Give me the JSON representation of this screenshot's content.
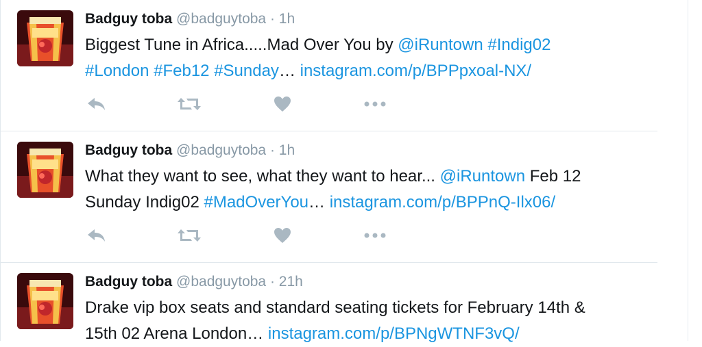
{
  "colors": {
    "name": "#14171a",
    "muted": "#8899a6",
    "link": "#1b95e0",
    "action_icon": "#aab8c2",
    "divider": "#e1e8ed",
    "avatar_box": "#e8502a",
    "avatar_bg": "#3a0a0c"
  },
  "tweets": [
    {
      "name": "Badguy toba",
      "handle": "@badguytoba",
      "sep": "·",
      "time": "1h",
      "text": {
        "p1": "Biggest Tune in Africa.....Mad Over You by ",
        "p2": "@iRuntown",
        "p3": " ",
        "p4": "#Indig02",
        "p5": "#London",
        "p6": " ",
        "p7": "#Feb12",
        "p8": " ",
        "p9": "#Sunday",
        "p10": "… ",
        "p11": "instagram.com/p/BPPpxoal-NX/"
      },
      "actions": [
        "reply-icon",
        "retweet-icon",
        "heart-icon",
        "more-icon"
      ]
    },
    {
      "name": "Badguy toba",
      "handle": "@badguytoba",
      "sep": "·",
      "time": "1h",
      "text": {
        "p1": "What they want to see, what they want to hear... ",
        "p2": "@iRuntown",
        "p3": " Feb 12",
        "p4": "Sunday Indig02 ",
        "p5": "#MadOverYou",
        "p6": "… ",
        "p7": "instagram.com/p/BPPnQ-Ilx06/"
      },
      "actions": [
        "reply-icon",
        "retweet-icon",
        "heart-icon",
        "more-icon"
      ]
    },
    {
      "name": "Badguy toba",
      "handle": "@badguytoba",
      "sep": "·",
      "time": "21h",
      "text": {
        "p1": "Drake vip box seats and standard seating tickets for February 14th &",
        "p2": "15th 02 Arena London… ",
        "p3": "instagram.com/p/BPNgWTNF3vQ/"
      }
    }
  ]
}
